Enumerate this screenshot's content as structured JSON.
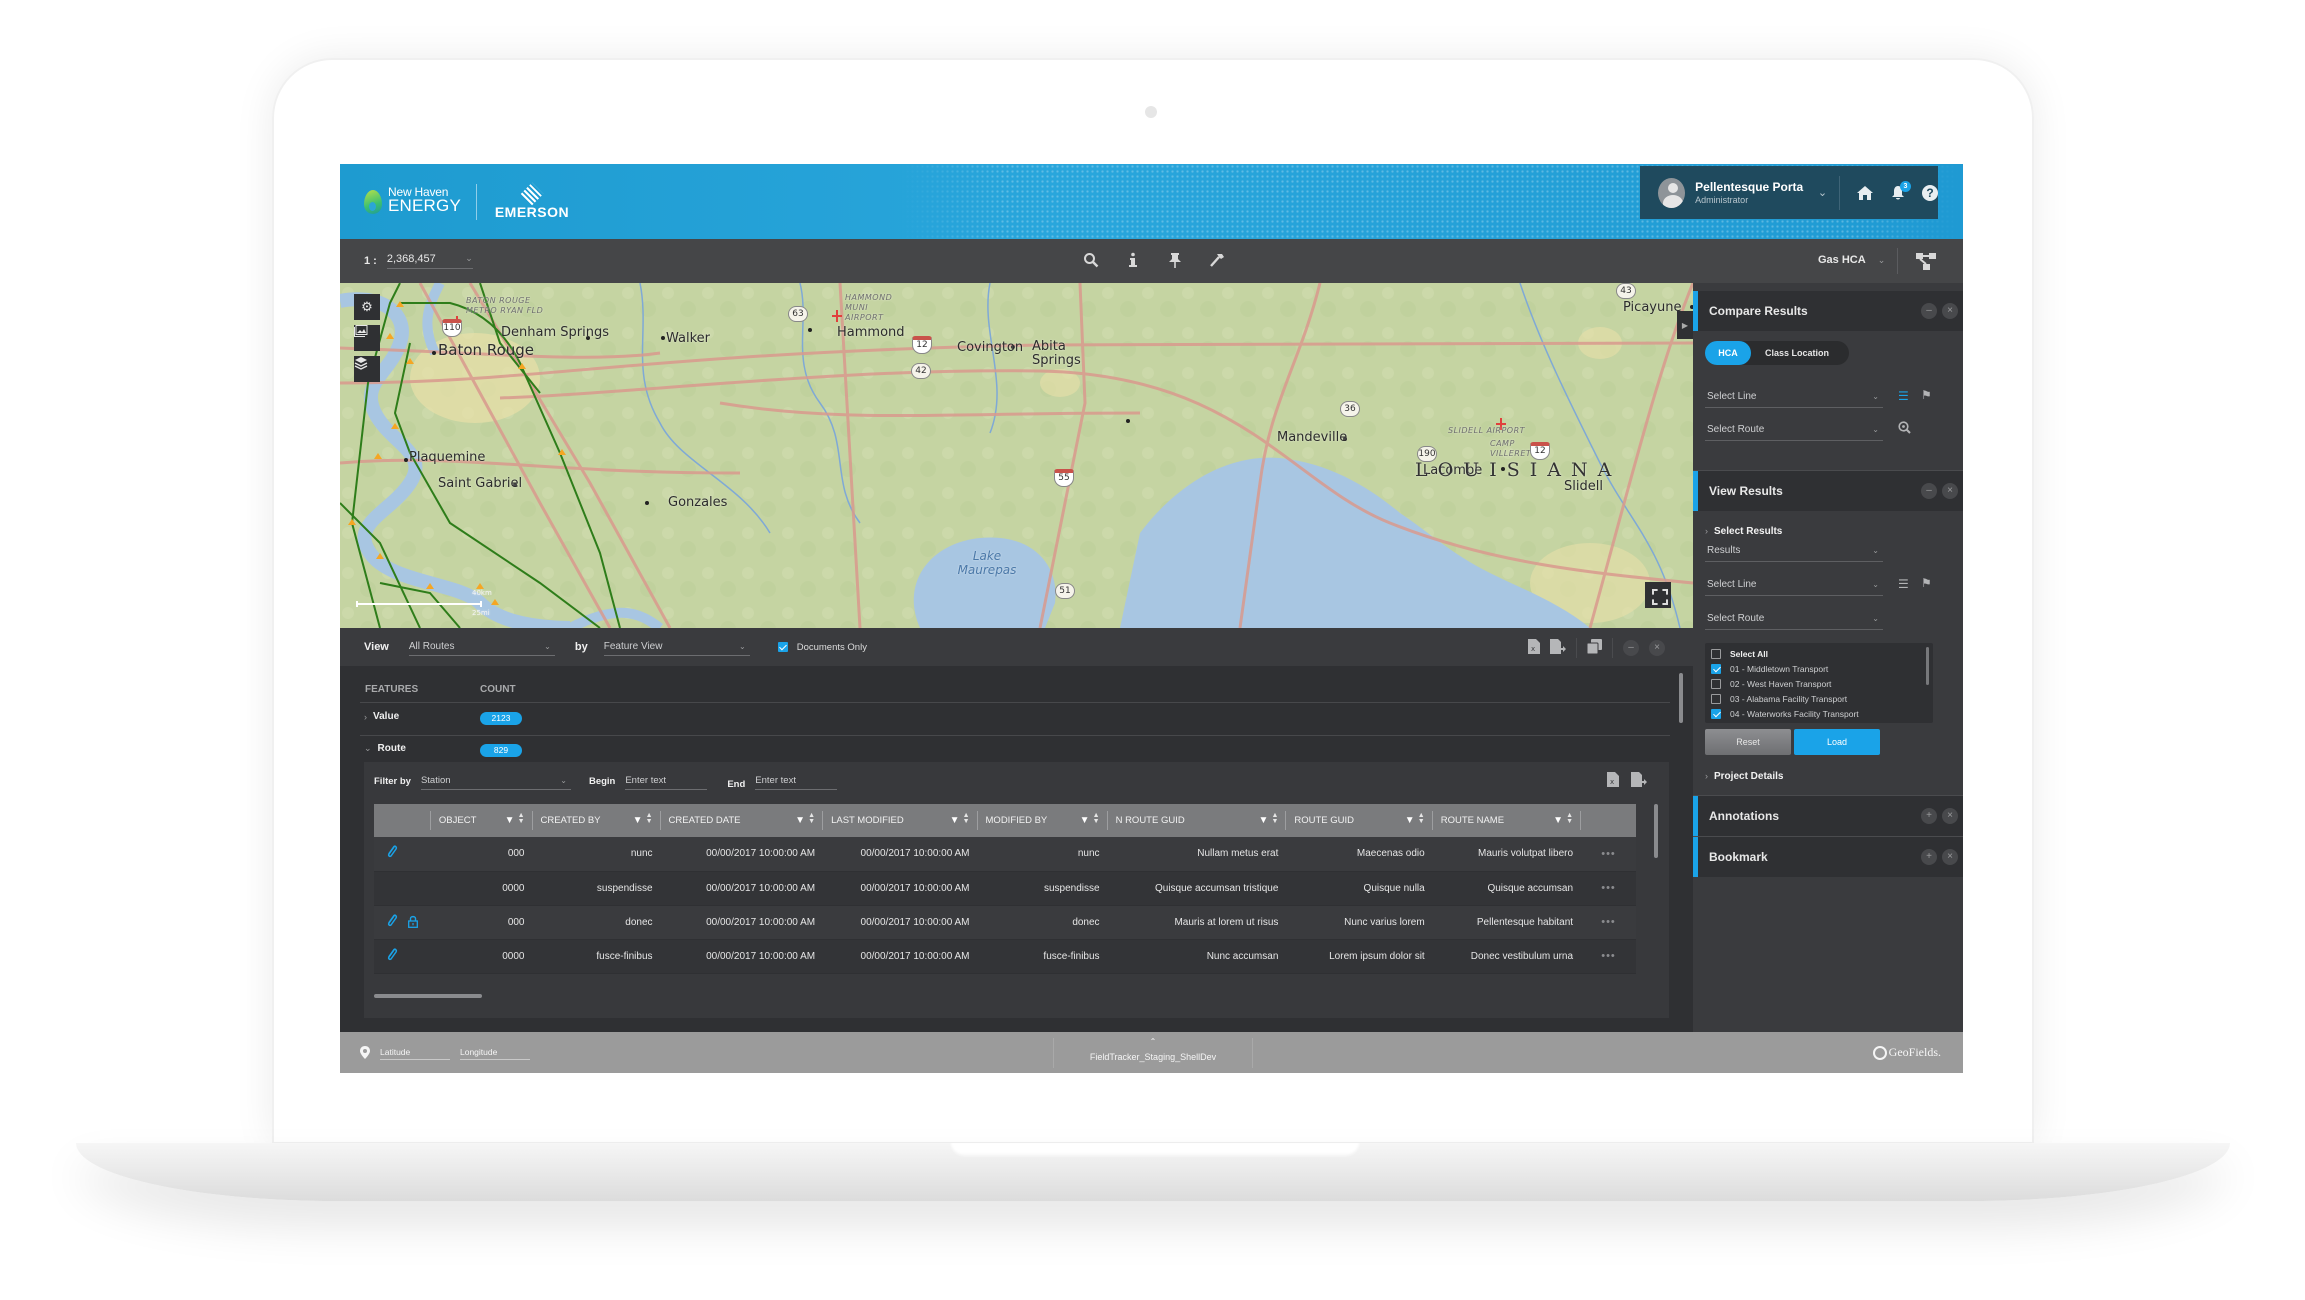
{
  "header": {
    "brand_line1": "New Haven",
    "brand_line2": "ENERGY",
    "partner": "EMERSON",
    "user_name": "Pellentesque Porta",
    "user_role": "Administrator",
    "notifications_count": "3",
    "icons": [
      "home-icon",
      "bell-icon",
      "help-icon"
    ]
  },
  "toolbar": {
    "scale_prefix": "1 :",
    "scale_value": "2,368,457",
    "tools": [
      "search-icon",
      "info-icon",
      "pin-icon",
      "hammer-icon"
    ],
    "layer": "Gas HCA"
  },
  "map": {
    "cities": [
      {
        "name": "Baton Rouge",
        "big": true
      },
      {
        "name": "Denham Springs"
      },
      {
        "name": "Walker"
      },
      {
        "name": "Hammond"
      },
      {
        "name": "Covington"
      },
      {
        "name": "Abita Springs"
      },
      {
        "name": "Picayune"
      },
      {
        "name": "Mandeville"
      },
      {
        "name": "Lacombe"
      },
      {
        "name": "Slidell"
      },
      {
        "name": "Plaquemine"
      },
      {
        "name": "Saint Gabriel"
      },
      {
        "name": "Gonzales"
      }
    ],
    "state": "LOUISIANA",
    "airports": [
      "BATON ROUGE METRO RYAN FLD",
      "HAMMOND MUNI AIRPORT",
      "SLIDELL AIRPORT",
      "CAMP VILLERETS"
    ],
    "water": "Lake Maurepas",
    "route_shields": [
      "110",
      "63",
      "12",
      "42",
      "55",
      "51",
      "36",
      "190",
      "12",
      "43"
    ],
    "scale_km": "40km",
    "scale_mi": "25mi",
    "controls": [
      "settings-icon",
      "gallery-icon",
      "layers-icon"
    ]
  },
  "compare": {
    "title": "Compare Results",
    "tab_active": "HCA",
    "tab_inactive": "Class Location",
    "select_line": "Select Line",
    "select_route": "Select Route"
  },
  "view_results": {
    "title": "View Results",
    "subsection": "Select Results",
    "results": "Results",
    "select_line": "Select Line",
    "select_route": "Select Route",
    "select_all": "Select All",
    "items": [
      {
        "label": "01 - Middletown Transport",
        "checked": true
      },
      {
        "label": "02 - West Haven Transport",
        "checked": false
      },
      {
        "label": "03 - Alabama Facility Transport",
        "checked": false
      },
      {
        "label": "04 - Waterworks Facility Transport",
        "checked": true
      }
    ],
    "reset": "Reset",
    "load": "Load",
    "project_details": "Project Details"
  },
  "annotations": {
    "title": "Annotations"
  },
  "bookmark": {
    "title": "Bookmark"
  },
  "bottom": {
    "view_label": "View",
    "view_value": "All Routes",
    "by_label": "by",
    "by_value": "Feature View",
    "documents_only": "Documents Only",
    "documents_only_checked": true,
    "features_header": "FEATURES",
    "count_header": "COUNT",
    "features": [
      {
        "name": "Value",
        "count": "2123",
        "expanded": false
      },
      {
        "name": "Route",
        "count": "829",
        "expanded": true
      }
    ],
    "filter_label": "Filter by",
    "filter_value": "Station",
    "begin_label": "Begin",
    "begin_placeholder": "Enter text",
    "end_label": "End",
    "end_placeholder": "Enter text",
    "columns": [
      "OBJECT",
      "CREATED BY",
      "CREATED DATE",
      "LAST MODIFIED",
      "MODIFIED BY",
      "N ROUTE GUID",
      "ROUTE GUID",
      "ROUTE NAME"
    ],
    "rows": [
      {
        "attach": true,
        "lock": false,
        "cells": [
          "000",
          "nunc",
          "00/00/2017  10:00:00 AM",
          "00/00/2017  10:00:00 AM",
          "nunc",
          "Nullam metus erat",
          "Maecenas odio",
          "Mauris volutpat libero"
        ]
      },
      {
        "attach": false,
        "lock": false,
        "cells": [
          "0000",
          "suspendisse",
          "00/00/2017  10:00:00 AM",
          "00/00/2017  10:00:00 AM",
          "suspendisse",
          "Quisque accumsan tristique",
          "Quisque nulla",
          "Quisque accumsan"
        ]
      },
      {
        "attach": true,
        "lock": true,
        "cells": [
          "000",
          "donec",
          "00/00/2017  10:00:00 AM",
          "00/00/2017  10:00:00 AM",
          "donec",
          "Mauris at lorem ut risus",
          "Nunc varius lorem",
          "Pellentesque habitant"
        ]
      },
      {
        "attach": true,
        "lock": false,
        "cells": [
          "0000",
          "fusce-finibus",
          "00/00/2017  10:00:00 AM",
          "00/00/2017  10:00:00 AM",
          "fusce-finibus",
          "Nunc accumsan",
          "Lorem ipsum dolor sit",
          "Donec vestibulum urna"
        ]
      }
    ],
    "more_label": "•••"
  },
  "status": {
    "latitude_placeholder": "Latitude",
    "longitude_placeholder": "Longitude",
    "environment": "FieldTracker_Staging_ShellDev",
    "brand": "GeoFields."
  },
  "colors": {
    "accent": "#1aa3e8",
    "header": "#29a6dc",
    "panel": "#2f3033",
    "toolbar": "#454648",
    "status_bar": "#9b9b9b"
  }
}
